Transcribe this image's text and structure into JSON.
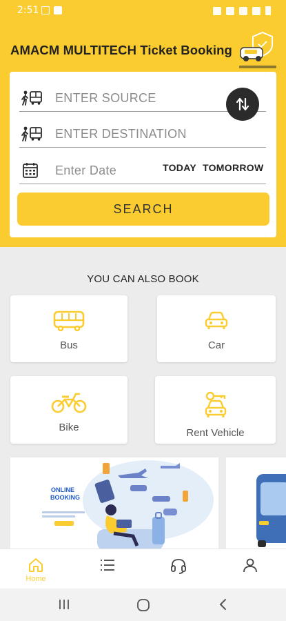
{
  "status_bar": {
    "time": "2:51"
  },
  "header": {
    "title": "AMACM MULTITECH Ticket Booking",
    "logo_text": "AMACM MULTITECH"
  },
  "form": {
    "source_placeholder": "ENTER SOURCE",
    "destination_placeholder": "ENTER DESTINATION",
    "date_placeholder": "Enter Date",
    "today_label": "TODAY",
    "tomorrow_label": "TOMORROW",
    "search_label": "SEARCH"
  },
  "also_book": {
    "heading": "YOU CAN ALSO BOOK",
    "items": [
      {
        "label": "Bus",
        "icon": "bus-icon"
      },
      {
        "label": "Car",
        "icon": "car-icon"
      },
      {
        "label": "Bike",
        "icon": "bike-icon"
      },
      {
        "label": "Rent Vehicle",
        "icon": "rent-vehicle-icon"
      }
    ]
  },
  "banner": {
    "line1": "ONLINE",
    "line2": "BOOKING"
  },
  "bottom_nav": {
    "home_label": "Home",
    "active": "home"
  },
  "colors": {
    "accent": "#fbcc2f",
    "dark": "#2b2b2b",
    "background": "#ececec"
  }
}
